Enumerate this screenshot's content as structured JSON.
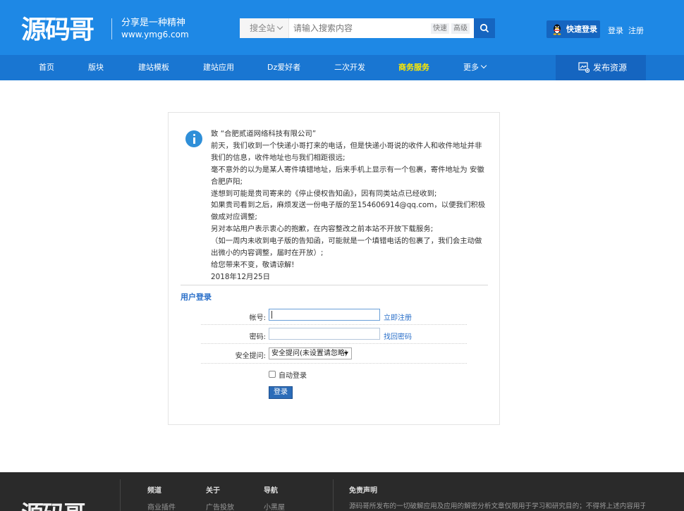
{
  "header": {
    "logo_text": "源码哥",
    "slogan": "分享是一种精神",
    "site_url": "www.ymg6.com",
    "search": {
      "scope": "搜全站",
      "placeholder": "请输入搜索内容",
      "tag_quick": "快速",
      "tag_advanced": "高级"
    },
    "quick_login": "快速登录",
    "login": "登录",
    "register": "注册"
  },
  "nav": {
    "items": [
      {
        "label": "首页"
      },
      {
        "label": "版块"
      },
      {
        "label": "建站模板"
      },
      {
        "label": "建站应用"
      },
      {
        "label": "Dz爱好者"
      },
      {
        "label": "二次开发"
      },
      {
        "label": "商务服务"
      },
      {
        "label": "更多"
      }
    ],
    "active": "商务服务",
    "publish": "发布资源"
  },
  "notice": {
    "lines": [
      "致 “合肥贰道网络科技有限公司”",
      "前天，我们收到一个快递小哥打来的电话，但是快递小哥说的收件人和收件地址并非我们的信息，收件地址也与我们相距很远;",
      "毫不意外的以为是某人寄件填错地址，后来手机上显示有一个包裹，寄件地址为 安徽合肥庐阳;",
      "遂想到可能是贵司寄来的《停止侵权告知函》，因有同类站点已经收到;",
      "如果贵司看到之后，麻烦发送一份电子版的至154606914@qq.com，以便我们积极做成对应调整;",
      "另对本站用户表示衷心的抱歉，在内容整改之前本站不开放下载服务;",
      "（如一周内未收到电子版的告知函，可能就是一个填错电话的包裹了，我们会主动做出微小的内容调整，届时在开放）;",
      "给您带来不变，敬请谅解!",
      "2018年12月25日"
    ]
  },
  "login": {
    "title": "用户登录",
    "account_label": "帐号:",
    "account_value": "",
    "register_now": "立即注册",
    "password_label": "密码:",
    "password_value": "",
    "find_password": "找回密码",
    "security_label": "安全提问:",
    "security_selected": "安全提问(未设置请忽略)",
    "auto_login": "自动登录",
    "submit": "登录"
  },
  "footer": {
    "logo_text": "源码哥",
    "col1_title": "频道",
    "col1_link": "商业插件",
    "col2_title": "关于",
    "col2_link": "广告投放",
    "col3_title": "导航",
    "col3_link": "小黑屋",
    "disclaimer_title": "免责声明",
    "disclaimer_text": "源码哥所发布的一切破解应用及应用的解密分析文章仅限用于学习和研究目的；不得将上述内容用于商业"
  },
  "colors": {
    "header_bg": "#1e88e5",
    "nav_bg": "#1976d2",
    "nav_active": "#ffea00",
    "link": "#2a6fc9",
    "footer_bg": "#2a2a2a"
  }
}
